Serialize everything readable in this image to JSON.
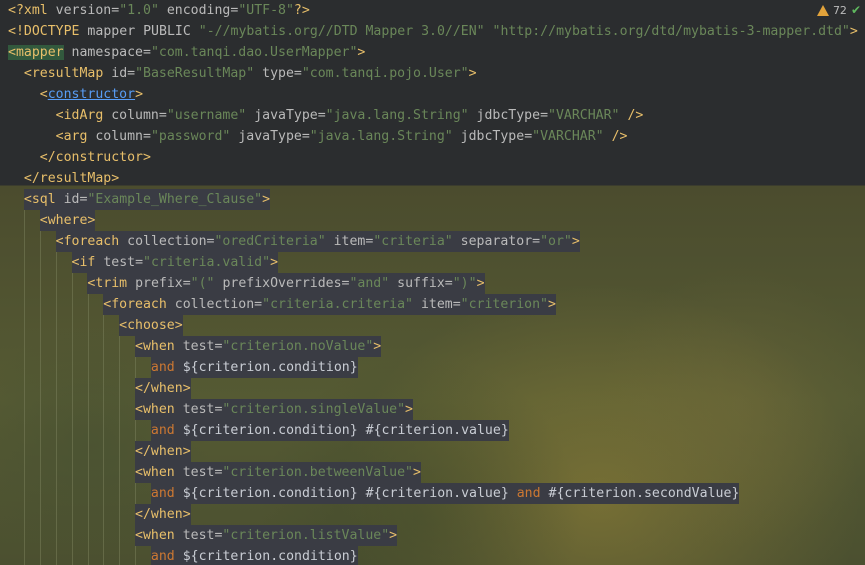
{
  "status": {
    "warnings": "72",
    "warning_icon": "warning-triangle-icon",
    "ok_icon": "check-icon"
  },
  "code": [
    [
      "<?xml version=\"1.0\" encoding=\"UTF-8\"?>"
    ],
    [
      "<!DOCTYPE mapper PUBLIC \"-//mybatis.org//DTD Mapper 3.0//EN\" \"http://mybatis.org/dtd/mybatis-3-mapper.dtd\">"
    ],
    [
      "<mapper namespace=\"com.tanqi.dao.UserMapper\">"
    ],
    [
      "  <resultMap id=\"BaseResultMap\" type=\"com.tanqi.pojo.User\">"
    ],
    [
      "    <constructor>"
    ],
    [
      "      <idArg column=\"username\" javaType=\"java.lang.String\" jdbcType=\"VARCHAR\" />"
    ],
    [
      "      <arg column=\"password\" javaType=\"java.lang.String\" jdbcType=\"VARCHAR\" />"
    ],
    [
      "    </constructor>"
    ],
    [
      "  </resultMap>"
    ],
    [
      "  <sql id=\"Example_Where_Clause\">"
    ],
    [
      "    <where>"
    ],
    [
      "      <foreach collection=\"oredCriteria\" item=\"criteria\" separator=\"or\">"
    ],
    [
      "        <if test=\"criteria.valid\">"
    ],
    [
      "          <trim prefix=\"(\" prefixOverrides=\"and\" suffix=\")\">"
    ],
    [
      "            <foreach collection=\"criteria.criteria\" item=\"criterion\">"
    ],
    [
      "              <choose>"
    ],
    [
      "                <when test=\"criterion.noValue\">"
    ],
    [
      "                  and ${criterion.condition}"
    ],
    [
      "                </when>"
    ],
    [
      "                <when test=\"criterion.singleValue\">"
    ],
    [
      "                  and ${criterion.condition} #{criterion.value}"
    ],
    [
      "                </when>"
    ],
    [
      "                <when test=\"criterion.betweenValue\">"
    ],
    [
      "                  and ${criterion.condition} #{criterion.value} and #{criterion.secondValue}"
    ],
    [
      "                </when>"
    ],
    [
      "                <when test=\"criterion.listValue\">"
    ],
    [
      "                  and ${criterion.condition}"
    ]
  ],
  "colors": {
    "tag": "#e8bf6a",
    "attribute": "#bababa",
    "value": "#6a8759",
    "keyword": "#cc7832",
    "link": "#589df6"
  }
}
